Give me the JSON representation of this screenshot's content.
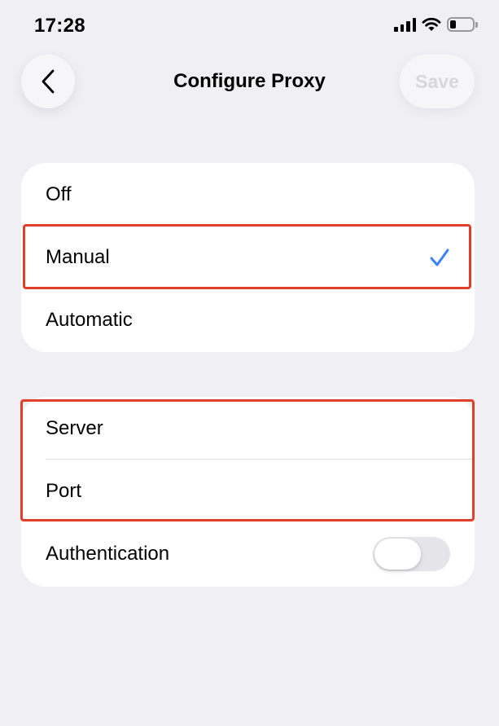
{
  "status_bar": {
    "time": "17:28",
    "icons": [
      "cellular-signal-icon",
      "wifi-icon",
      "battery-icon"
    ]
  },
  "nav": {
    "title": "Configure Proxy",
    "back_icon": "chevron-left-icon",
    "save_label": "Save"
  },
  "proxy_modes": {
    "items": [
      {
        "label": "Off",
        "selected": false
      },
      {
        "label": "Manual",
        "selected": true
      },
      {
        "label": "Automatic",
        "selected": false
      }
    ],
    "selected_icon": "checkmark-icon"
  },
  "server_settings": {
    "server_label": "Server",
    "port_label": "Port",
    "authentication_label": "Authentication",
    "authentication_enabled": false
  },
  "colors": {
    "background": "#efeff4",
    "card": "#ffffff",
    "accent": "#3b82f6",
    "highlight": "#e0402a",
    "save_disabled": "#d7d7dc"
  }
}
